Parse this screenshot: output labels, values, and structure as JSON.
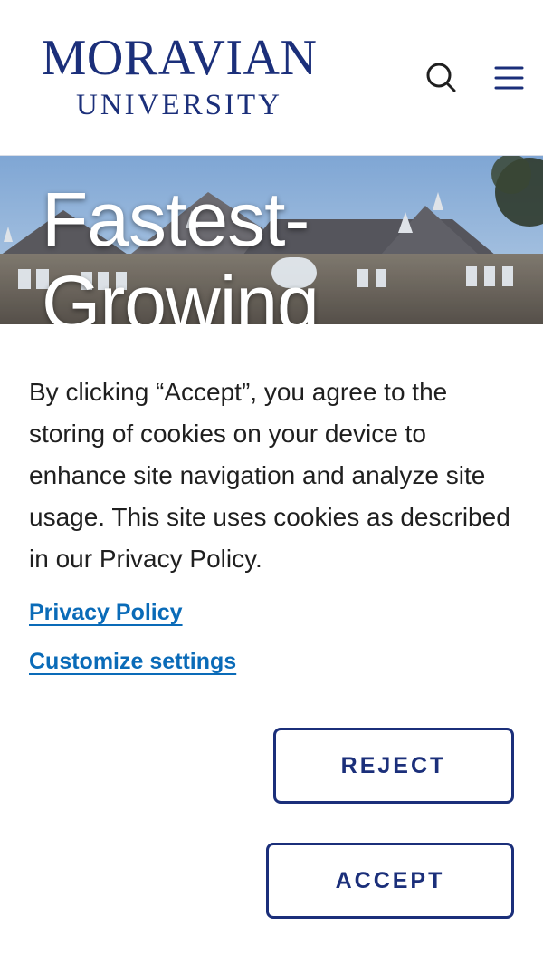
{
  "header": {
    "logo": {
      "line1": "MORAVIAN",
      "line2": "UNIVERSITY"
    },
    "search_icon": "search-icon",
    "menu_icon": "hamburger-menu-icon",
    "brand_color": "#1b2f7a"
  },
  "hero": {
    "title": "Fastest-\nGrowing"
  },
  "cookie_banner": {
    "message": "By clicking “Accept”, you agree to the storing of cookies on your device to enhance site navigation and analyze site usage. This site uses cookies as described in our Privacy Policy.",
    "privacy_link": "Privacy Policy",
    "customize_link": "Customize settings",
    "reject_label": "REJECT",
    "accept_label": "ACCEPT",
    "link_color": "#0a6bb8"
  }
}
